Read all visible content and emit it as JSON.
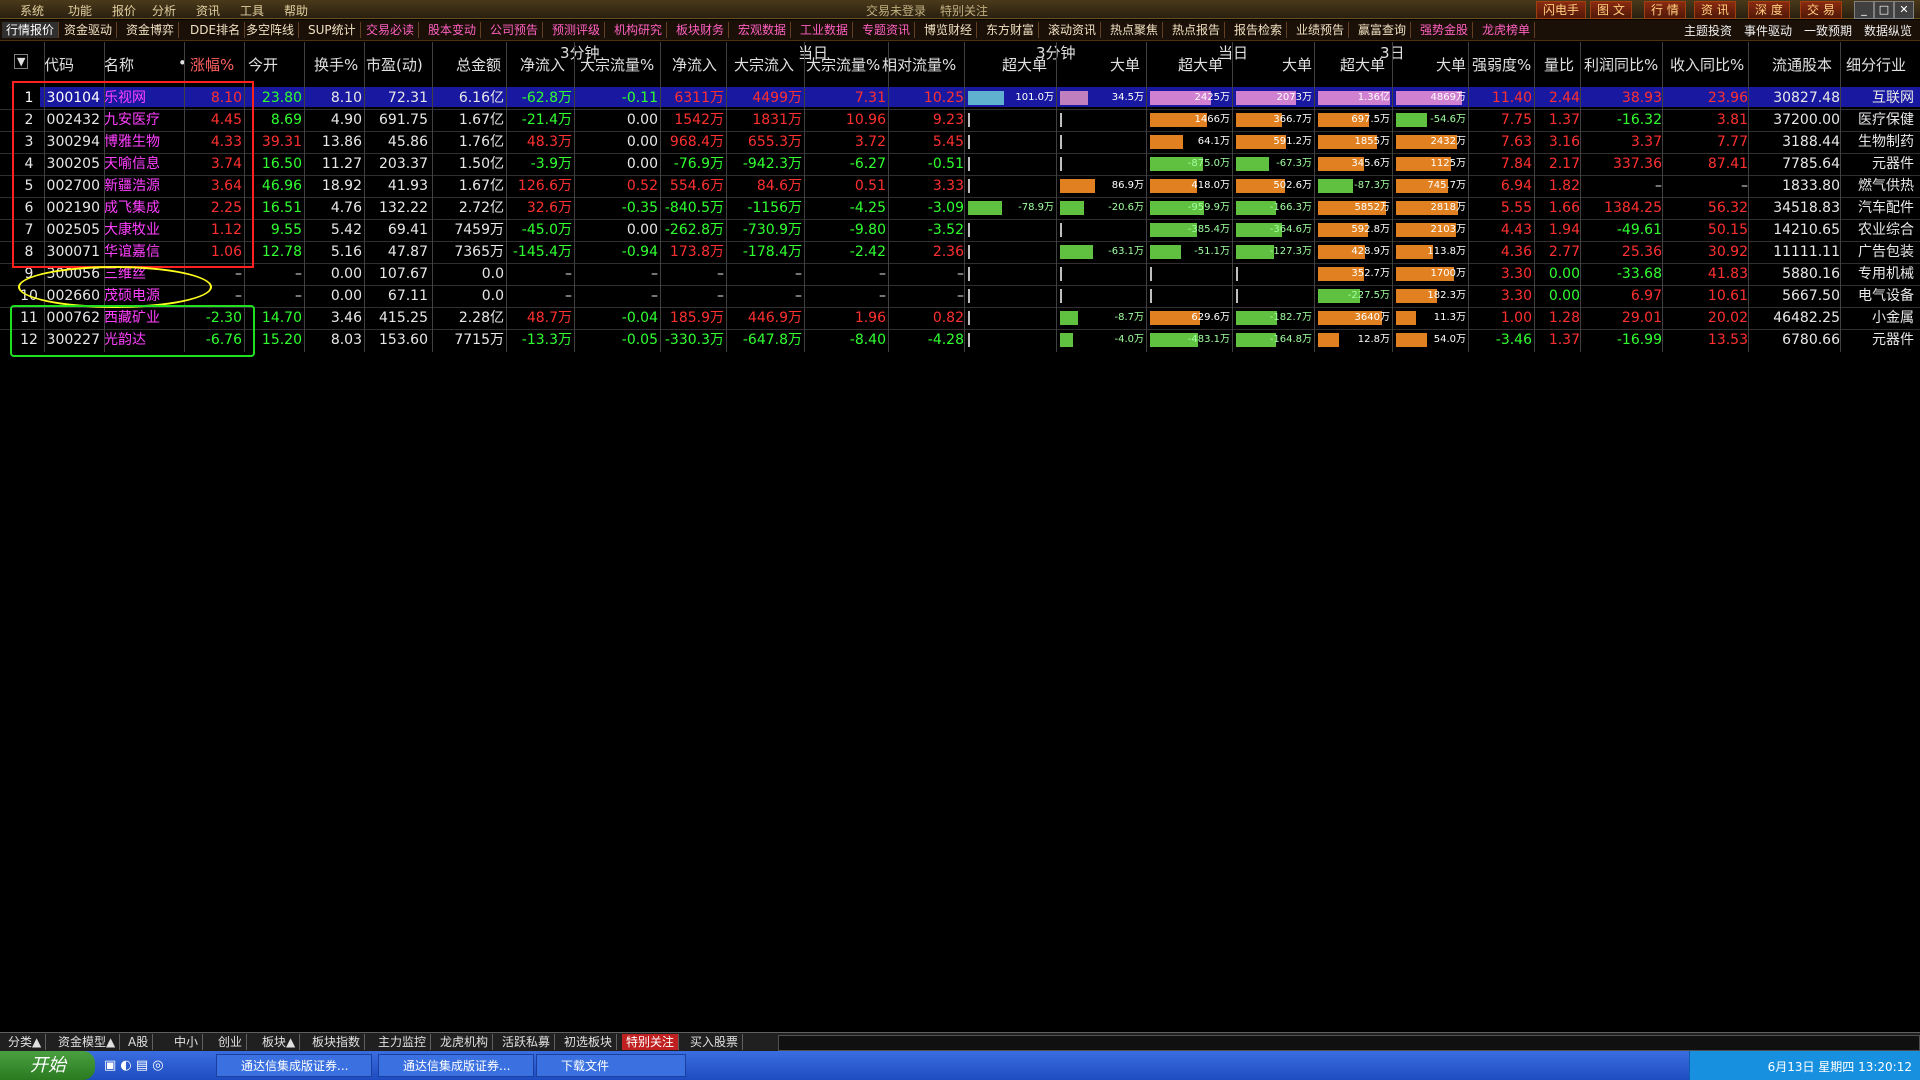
{
  "menubar": {
    "items": [
      "系统",
      "功能",
      "报价",
      "分析",
      "资讯",
      "工具",
      "帮助"
    ],
    "center": [
      "交易未登录",
      "特别关注"
    ],
    "right_buttons": [
      "闪电手",
      "图 文",
      "行 情",
      "资 讯",
      "深 度",
      "交 易"
    ]
  },
  "tabs": [
    "行情报价",
    "资金驱动",
    "资金博弈",
    "DDE排名",
    "多空阵线",
    "SUP统计",
    "交易必读",
    "股本变动",
    "公司预告",
    "预测评级",
    "机构研究",
    "板块财务",
    "宏观数据",
    "工业数据",
    "专题资讯",
    "博览财经",
    "东方财富",
    "滚动资讯",
    "热点聚焦",
    "热点报告",
    "报告检索",
    "业绩预告",
    "赢富查询",
    "强势金股",
    "龙虎榜单"
  ],
  "tabs_right": [
    "主题投资",
    "事件驱动",
    "一致预期",
    "数据纵览"
  ],
  "headers": {
    "groups": {
      "g1": "3分钟",
      "g2": "当日",
      "g3": "3分钟",
      "g4": "当日",
      "g5": "3日"
    },
    "cols": [
      "代码",
      "名称",
      "•",
      "涨幅%",
      "今开",
      "换手%",
      "市盈(动)",
      "总金额",
      "净流入",
      "大宗流量%",
      "净流入",
      "大宗流入",
      "大宗流量%",
      "相对流量%",
      "超大单",
      "大单",
      "超大单",
      "大单",
      "超大单",
      "大单",
      "强弱度%",
      "量比",
      "利润同比%",
      "收入同比%",
      "流通股本",
      "细分行业"
    ]
  },
  "rows": [
    {
      "n": "1",
      "code": "300104",
      "name": "乐视网",
      "chg": "8.10",
      "open": "23.80",
      "turn": "8.10",
      "pe": "72.31",
      "amt": "6.16亿",
      "n3": "-62.8万",
      "dz3": "-0.11",
      "nd": "6311万",
      "dzin": "4499万",
      "dzd": "7.31",
      "rel": "10.25",
      "b1": "101.0万",
      "b2": "34.5万",
      "b3": "2425万",
      "b4": "2073万",
      "b5": "1.36亿",
      "b6": "4869万",
      "str": "11.40",
      "vr": "2.44",
      "profit": "38.93",
      "rev": "23.96",
      "float": "30827.48",
      "ind": "互联网"
    },
    {
      "n": "2",
      "code": "002432",
      "name": "九安医疗",
      "chg": "4.45",
      "open": "8.69",
      "turn": "4.90",
      "pe": "691.75",
      "amt": "1.67亿",
      "n3": "-21.4万",
      "dz3": "0.00",
      "nd": "1542万",
      "dzin": "1831万",
      "dzd": "10.96",
      "rel": "9.23",
      "b1": "",
      "b2": "",
      "b3": "1466万",
      "b4": "366.7万",
      "b5": "697.5万",
      "b6": "-54.6万",
      "str": "7.75",
      "vr": "1.37",
      "profit": "-16.32",
      "rev": "3.81",
      "float": "37200.00",
      "ind": "医疗保健"
    },
    {
      "n": "3",
      "code": "300294",
      "name": "博雅生物",
      "chg": "4.33",
      "open": "39.31",
      "turn": "13.86",
      "pe": "45.86",
      "amt": "1.76亿",
      "n3": "48.3万",
      "dz3": "0.00",
      "nd": "968.4万",
      "dzin": "655.3万",
      "dzd": "3.72",
      "rel": "5.45",
      "b1": "",
      "b2": "",
      "b3": "64.1万",
      "b4": "591.2万",
      "b5": "1855万",
      "b6": "2432万",
      "str": "7.63",
      "vr": "3.16",
      "profit": "3.37",
      "rev": "7.77",
      "float": "3188.44",
      "ind": "生物制药"
    },
    {
      "n": "4",
      "code": "300205",
      "name": "天喻信息",
      "chg": "3.74",
      "open": "16.50",
      "turn": "11.27",
      "pe": "203.37",
      "amt": "1.50亿",
      "n3": "-3.9万",
      "dz3": "0.00",
      "nd": "-76.9万",
      "dzin": "-942.3万",
      "dzd": "-6.27",
      "rel": "-0.51",
      "b1": "",
      "b2": "",
      "b3": "-875.0万",
      "b4": "-67.3万",
      "b5": "345.6万",
      "b6": "1125万",
      "str": "7.84",
      "vr": "2.17",
      "profit": "337.36",
      "rev": "87.41",
      "float": "7785.64",
      "ind": "元器件"
    },
    {
      "n": "5",
      "code": "002700",
      "name": "新疆浩源",
      "chg": "3.64",
      "open": "46.96",
      "turn": "18.92",
      "pe": "41.93",
      "amt": "1.67亿",
      "n3": "126.6万",
      "dz3": "0.52",
      "nd": "554.6万",
      "dzin": "84.6万",
      "dzd": "0.51",
      "rel": "3.33",
      "b1": "",
      "b2": "86.9万",
      "b3": "418.0万",
      "b4": "502.6万",
      "b5": "-87.3万",
      "b6": "745.7万",
      "str": "6.94",
      "vr": "1.82",
      "profit": "–",
      "rev": "–",
      "float": "1833.80",
      "ind": "燃气供热"
    },
    {
      "n": "6",
      "code": "002190",
      "name": "成飞集成",
      "chg": "2.25",
      "open": "16.51",
      "turn": "4.76",
      "pe": "132.22",
      "amt": "2.72亿",
      "n3": "32.6万",
      "dz3": "-0.35",
      "nd": "-840.5万",
      "dzin": "-1156万",
      "dzd": "-4.25",
      "rel": "-3.09",
      "b1": "-78.9万",
      "b2": "-20.6万",
      "b3": "-959.9万",
      "b4": "-166.3万",
      "b5": "5852万",
      "b6": "2818万",
      "str": "5.55",
      "vr": "1.66",
      "profit": "1384.25",
      "rev": "56.32",
      "float": "34518.83",
      "ind": "汽车配件"
    },
    {
      "n": "7",
      "code": "002505",
      "name": "大康牧业",
      "chg": "1.12",
      "open": "9.55",
      "turn": "5.42",
      "pe": "69.41",
      "amt": "7459万",
      "n3": "-45.0万",
      "dz3": "0.00",
      "nd": "-262.8万",
      "dzin": "-730.9万",
      "dzd": "-9.80",
      "rel": "-3.52",
      "b1": "",
      "b2": "",
      "b3": "-385.4万",
      "b4": "-364.6万",
      "b5": "592.8万",
      "b6": "2103万",
      "str": "4.43",
      "vr": "1.94",
      "profit": "-49.61",
      "rev": "50.15",
      "float": "14210.65",
      "ind": "农业综合"
    },
    {
      "n": "8",
      "code": "300071",
      "name": "华谊嘉信",
      "chg": "1.06",
      "open": "12.78",
      "turn": "5.16",
      "pe": "47.87",
      "amt": "7365万",
      "n3": "-145.4万",
      "dz3": "-0.94",
      "nd": "173.8万",
      "dzin": "-178.4万",
      "dzd": "-2.42",
      "rel": "2.36",
      "b1": "",
      "b2": "-63.1万",
      "b3": "-51.1万",
      "b4": "-127.3万",
      "b5": "428.9万",
      "b6": "113.8万",
      "str": "4.36",
      "vr": "2.77",
      "profit": "25.36",
      "rev": "30.92",
      "float": "11111.11",
      "ind": "广告包装"
    },
    {
      "n": "9",
      "code": "300056",
      "name": "三维丝",
      "chg": "–",
      "open": "–",
      "turn": "0.00",
      "pe": "107.67",
      "amt": "0.0",
      "n3": "–",
      "dz3": "–",
      "nd": "–",
      "dzin": "–",
      "dzd": "–",
      "rel": "–",
      "b1": "",
      "b2": "",
      "b3": "",
      "b4": "",
      "b5": "352.7万",
      "b6": "1700万",
      "str": "3.30",
      "vr": "0.00",
      "profit": "-33.68",
      "rev": "41.83",
      "float": "5880.16",
      "ind": "专用机械"
    },
    {
      "n": "10",
      "code": "002660",
      "name": "茂硕电源",
      "chg": "–",
      "open": "–",
      "turn": "0.00",
      "pe": "67.11",
      "amt": "0.0",
      "n3": "–",
      "dz3": "–",
      "nd": "–",
      "dzin": "–",
      "dzd": "–",
      "rel": "–",
      "b1": "",
      "b2": "",
      "b3": "",
      "b4": "",
      "b5": "-227.5万",
      "b6": "182.3万",
      "str": "3.30",
      "vr": "0.00",
      "profit": "6.97",
      "rev": "10.61",
      "float": "5667.50",
      "ind": "电气设备"
    },
    {
      "n": "11",
      "code": "000762",
      "name": "西藏矿业",
      "chg": "-2.30",
      "open": "14.70",
      "turn": "3.46",
      "pe": "415.25",
      "amt": "2.28亿",
      "n3": "48.7万",
      "dz3": "-0.04",
      "nd": "185.9万",
      "dzin": "446.9万",
      "dzd": "1.96",
      "rel": "0.82",
      "b1": "",
      "b2": "-8.7万",
      "b3": "629.6万",
      "b4": "-182.7万",
      "b5": "3640万",
      "b6": "11.3万",
      "str": "1.00",
      "vr": "1.28",
      "profit": "29.01",
      "rev": "20.02",
      "float": "46482.25",
      "ind": "小金属"
    },
    {
      "n": "12",
      "code": "300227",
      "name": "光韵达",
      "chg": "-6.76",
      "open": "15.20",
      "turn": "8.03",
      "pe": "153.60",
      "amt": "7715万",
      "n3": "-13.3万",
      "dz3": "-0.05",
      "nd": "-330.3万",
      "dzin": "-647.8万",
      "dzd": "-8.40",
      "rel": "-4.28",
      "b1": "",
      "b2": "-4.0万",
      "b3": "-483.1万",
      "b4": "-164.8万",
      "b5": "12.8万",
      "b6": "54.0万",
      "str": "-3.46",
      "vr": "1.37",
      "profit": "-16.99",
      "rev": "13.53",
      "float": "6780.66",
      "ind": "元器件"
    }
  ],
  "bottom_tabs": [
    "分类▲",
    "资金模型▲",
    "A股",
    "中小",
    "创业",
    "板块▲",
    "板块指数",
    "主力监控",
    "龙虎机构",
    "活跃私募",
    "初选板块",
    "特别关注",
    "买入股票"
  ],
  "taskbar": {
    "start": "开始",
    "tasks": [
      "通达信集成版证券...",
      "通达信集成版证券...",
      "下载文件"
    ],
    "clock": "6月13日 星期四 13:20:12"
  }
}
